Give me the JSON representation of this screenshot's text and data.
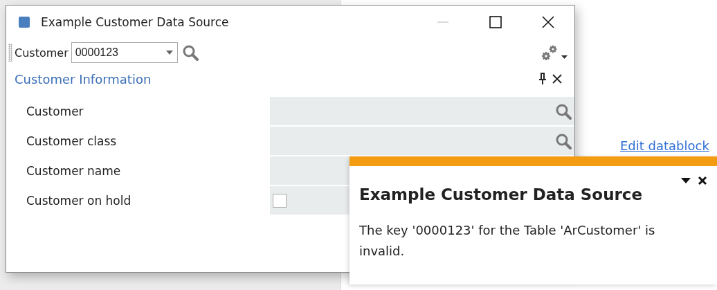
{
  "background": {
    "link": "Edit datablock"
  },
  "window": {
    "title": "Example Customer Data Source",
    "minimize_disabled": true
  },
  "toolbar": {
    "label": "Customer",
    "value": "0000123"
  },
  "section": {
    "title": "Customer Information"
  },
  "fields": [
    {
      "label": "Customer",
      "kind": "lookup"
    },
    {
      "label": "Customer class",
      "kind": "lookup"
    },
    {
      "label": "Customer name",
      "kind": "text"
    },
    {
      "label": "Customer on hold",
      "kind": "checkbox",
      "checked": false
    }
  ],
  "notification": {
    "title": "Example Customer Data Source",
    "message": "The key '0000123' for the Table 'ArCustomer' is invalid."
  }
}
